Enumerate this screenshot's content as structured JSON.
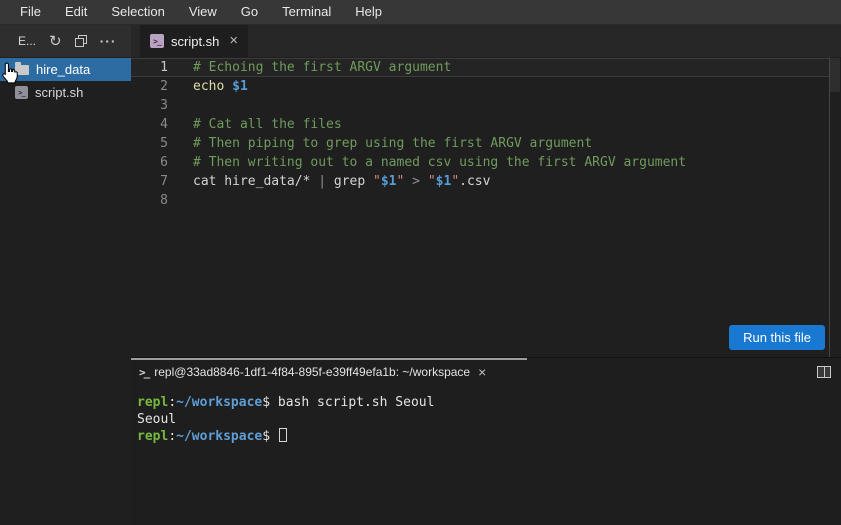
{
  "menu_bar": {
    "items": [
      "File",
      "Edit",
      "Selection",
      "View",
      "Go",
      "Terminal",
      "Help"
    ]
  },
  "explorer": {
    "header_label": "E...",
    "actions": {
      "refresh_glyph": "↻",
      "more_glyph": "···"
    },
    "files": [
      {
        "name": "hire_data",
        "kind": "folder",
        "selected": true
      },
      {
        "name": "script.sh",
        "kind": "shell-script",
        "selected": false
      }
    ]
  },
  "editor_tabs": {
    "active_tab": {
      "icon_glyph": ">_",
      "label": "script.sh",
      "close_glyph": "×"
    }
  },
  "editor": {
    "active_line": 1,
    "run_button_label": "Run this file",
    "lines": [
      {
        "num": 1,
        "tokens": [
          {
            "c": "comment",
            "t": "# Echoing the first ARGV argument"
          }
        ]
      },
      {
        "num": 2,
        "tokens": [
          {
            "c": "builtin",
            "t": "echo "
          },
          {
            "c": "variable",
            "t": "$1"
          }
        ]
      },
      {
        "num": 3,
        "tokens": []
      },
      {
        "num": 4,
        "tokens": [
          {
            "c": "comment",
            "t": "# Cat all the files"
          }
        ]
      },
      {
        "num": 5,
        "tokens": [
          {
            "c": "comment",
            "t": "# Then piping to grep using the first ARGV argument"
          }
        ]
      },
      {
        "num": 6,
        "tokens": [
          {
            "c": "comment",
            "t": "# Then writing out to a named csv using the first ARGV argument"
          }
        ]
      },
      {
        "num": 7,
        "tokens": [
          {
            "c": "plain",
            "t": "cat hire_data/* "
          },
          {
            "c": "operator",
            "t": "| "
          },
          {
            "c": "plain",
            "t": "grep "
          },
          {
            "c": "string",
            "t": "\""
          },
          {
            "c": "variable",
            "t": "$1"
          },
          {
            "c": "string",
            "t": "\""
          },
          {
            "c": "plain",
            "t": " "
          },
          {
            "c": "operator",
            "t": "> "
          },
          {
            "c": "string",
            "t": "\""
          },
          {
            "c": "variable",
            "t": "$1"
          },
          {
            "c": "string",
            "t": "\""
          },
          {
            "c": "plain",
            "t": ".csv"
          }
        ]
      },
      {
        "num": 8,
        "tokens": []
      }
    ]
  },
  "terminal": {
    "tab": {
      "icon_glyph": ">_",
      "title": "repl@33ad8846-1df1-4f84-895f-e39ff49efa1b: ~/workspace",
      "close_glyph": "×"
    },
    "lines": [
      {
        "cursor": false,
        "tokens": [
          {
            "c": "user",
            "t": "repl"
          },
          {
            "c": "term_plain",
            "t": ":"
          },
          {
            "c": "path",
            "t": "~/workspace"
          },
          {
            "c": "term_plain",
            "t": "$ "
          },
          {
            "c": "term_plain",
            "t": "bash script.sh Seoul"
          }
        ]
      },
      {
        "cursor": false,
        "tokens": [
          {
            "c": "term_plain",
            "t": "Seoul"
          }
        ]
      },
      {
        "cursor": true,
        "tokens": [
          {
            "c": "user",
            "t": "repl"
          },
          {
            "c": "term_plain",
            "t": ":"
          },
          {
            "c": "path",
            "t": "~/workspace"
          },
          {
            "c": "term_plain",
            "t": "$ "
          }
        ]
      }
    ]
  },
  "colors": {
    "accent_blue": "#1878d2",
    "selection_blue": "#2d6ba3",
    "syntax": {
      "comment": "#6f9b5d",
      "builtin": "#dcdcaa",
      "variable": "#569cd6",
      "plain": "#d4d4d4",
      "operator": "#929292",
      "string": "#ce9178",
      "user": "#76b93e",
      "path": "#5e9ed6",
      "term_plain": "#e4e4e4"
    }
  }
}
